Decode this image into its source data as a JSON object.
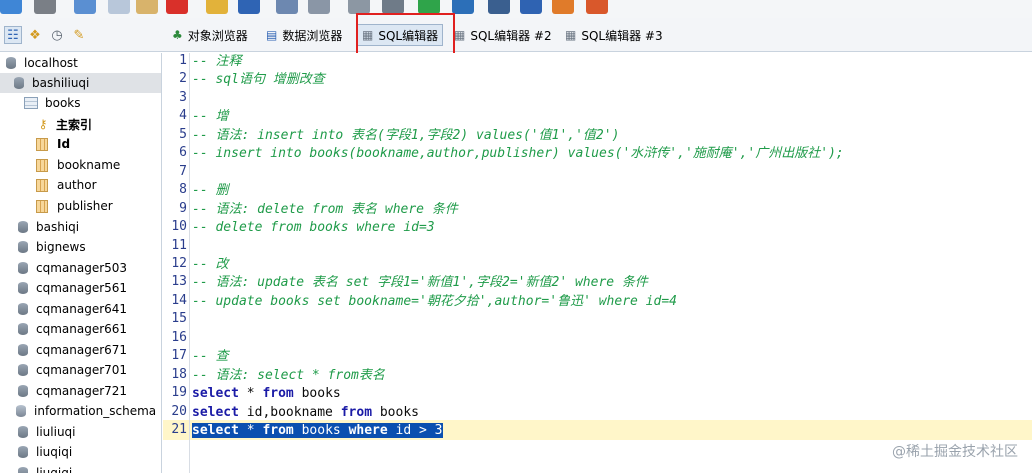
{
  "toolbar": {
    "icons": [
      "refresh-icon",
      "stop-icon",
      "link-icon",
      "copy-icon",
      "paste-icon",
      "delete-icon",
      "open-folder-icon",
      "save-icon",
      "undo-icon",
      "redo-icon",
      "tools-icon",
      "tools2-icon",
      "run-icon",
      "run-all-icon",
      "first-icon",
      "last-icon",
      "import-icon",
      "export-icon"
    ]
  },
  "row2": {
    "left_icons": [
      "tree-view-icon",
      "tables-icon",
      "history-icon",
      "favorites-icon"
    ],
    "tabs": [
      {
        "label": "对象浏览器",
        "icon": "object-browser-icon"
      },
      {
        "label": "数据浏览器",
        "icon": "data-browser-icon"
      },
      {
        "label": "SQL编辑器",
        "icon": "sql-editor-icon",
        "active": true
      },
      {
        "label": "SQL编辑器 #2",
        "icon": "sql-editor-icon"
      },
      {
        "label": "SQL编辑器 #3",
        "icon": "sql-editor-icon"
      }
    ]
  },
  "sidebar": {
    "items": [
      {
        "label": "localhost",
        "type": "server"
      },
      {
        "label": "bashiliuqi",
        "type": "db",
        "selected": true
      },
      {
        "label": "books",
        "type": "table"
      },
      {
        "label": "主索引",
        "type": "key",
        "bold": true
      },
      {
        "label": "Id",
        "type": "column",
        "bold": true
      },
      {
        "label": "bookname",
        "type": "column"
      },
      {
        "label": "author",
        "type": "column"
      },
      {
        "label": "publisher",
        "type": "column"
      },
      {
        "label": "bashiqi",
        "type": "db"
      },
      {
        "label": "bignews",
        "type": "db"
      },
      {
        "label": "cqmanager503",
        "type": "db"
      },
      {
        "label": "cqmanager561",
        "type": "db"
      },
      {
        "label": "cqmanager641",
        "type": "db"
      },
      {
        "label": "cqmanager661",
        "type": "db"
      },
      {
        "label": "cqmanager671",
        "type": "db"
      },
      {
        "label": "cqmanager701",
        "type": "db"
      },
      {
        "label": "cqmanager721",
        "type": "db"
      },
      {
        "label": "information_schema",
        "type": "info"
      },
      {
        "label": "liuliuqi",
        "type": "db"
      },
      {
        "label": "liuqiqi",
        "type": "db"
      },
      {
        "label": "liuqiqi",
        "type": "db"
      }
    ]
  },
  "editor": {
    "lines": [
      {
        "n": "1",
        "segs": [
          {
            "t": "-- 注释",
            "c": "cmt"
          }
        ]
      },
      {
        "n": "2",
        "segs": [
          {
            "t": "-- sql语句 增删改查",
            "c": "cmt"
          }
        ]
      },
      {
        "n": "3",
        "segs": []
      },
      {
        "n": "4",
        "segs": [
          {
            "t": "-- 增",
            "c": "cmt"
          }
        ]
      },
      {
        "n": "5",
        "segs": [
          {
            "t": "-- 语法: insert into 表名(字段1,字段2) values('值1','值2')",
            "c": "cmt"
          }
        ]
      },
      {
        "n": "6",
        "segs": [
          {
            "t": "-- insert into books(bookname,author,publisher) values('水浒传','施耐庵','广州出版社');",
            "c": "cmt"
          }
        ]
      },
      {
        "n": "7",
        "segs": []
      },
      {
        "n": "8",
        "segs": [
          {
            "t": "-- 删",
            "c": "cmt"
          }
        ]
      },
      {
        "n": "9",
        "segs": [
          {
            "t": "-- 语法: delete from 表名 where 条件",
            "c": "cmt"
          }
        ]
      },
      {
        "n": "10",
        "segs": [
          {
            "t": "-- delete from books where id=3",
            "c": "cmt"
          }
        ]
      },
      {
        "n": "11",
        "segs": []
      },
      {
        "n": "12",
        "segs": [
          {
            "t": "-- 改",
            "c": "cmt"
          }
        ]
      },
      {
        "n": "13",
        "segs": [
          {
            "t": "-- 语法: update 表名 set 字段1='新值1',字段2='新值2' where 条件",
            "c": "cmt"
          }
        ]
      },
      {
        "n": "14",
        "segs": [
          {
            "t": "-- update books set bookname='朝花夕拾',author='鲁迅' where id=4",
            "c": "cmt"
          }
        ]
      },
      {
        "n": "15",
        "segs": []
      },
      {
        "n": "16",
        "segs": []
      },
      {
        "n": "17",
        "segs": [
          {
            "t": "-- 查",
            "c": "cmt"
          }
        ]
      },
      {
        "n": "18",
        "segs": [
          {
            "t": "-- 语法: select * from表名",
            "c": "cmt"
          }
        ]
      },
      {
        "n": "19",
        "segs": [
          {
            "t": "select",
            "c": "kw"
          },
          {
            "t": " * ",
            "c": "tx"
          },
          {
            "t": "from",
            "c": "kw"
          },
          {
            "t": " books",
            "c": "tx"
          }
        ]
      },
      {
        "n": "20",
        "segs": [
          {
            "t": "select",
            "c": "kw"
          },
          {
            "t": " id,bookname ",
            "c": "tx"
          },
          {
            "t": "from",
            "c": "kw"
          },
          {
            "t": " books",
            "c": "tx"
          }
        ]
      },
      {
        "n": "21",
        "segs": [
          {
            "t": "select",
            "c": "kw"
          },
          {
            "t": " * ",
            "c": "tx"
          },
          {
            "t": "from",
            "c": "kw"
          },
          {
            "t": " books ",
            "c": "tx"
          },
          {
            "t": "where",
            "c": "kw"
          },
          {
            "t": " id > 3",
            "c": "tx"
          }
        ],
        "selected": true
      }
    ]
  },
  "watermark": "@稀土掘金技术社区",
  "colors": {
    "accent": "#0b4fb0",
    "comment": "#1f9b49",
    "keyword": "#1a1aa6",
    "highlight_box": "#e0201f",
    "current_line": "#fff6c9"
  }
}
